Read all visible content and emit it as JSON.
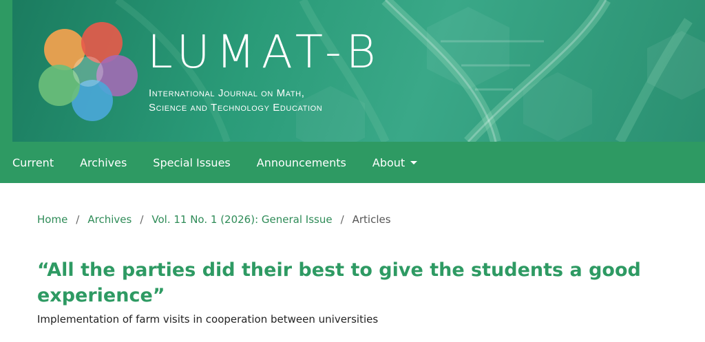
{
  "header": {
    "brand_title": "LUMAT-B",
    "brand_subtitle_line1": "International Journal on Math,",
    "brand_subtitle_line2": "Science and Technology Education"
  },
  "nav": {
    "items": [
      {
        "label": "Current"
      },
      {
        "label": "Archives"
      },
      {
        "label": "Special Issues"
      },
      {
        "label": "Announcements"
      },
      {
        "label": "About"
      }
    ]
  },
  "breadcrumb": {
    "home": "Home",
    "archives": "Archives",
    "issue": "Vol. 11 No. 1 (2026): General Issue",
    "current": "Articles",
    "separator": "/"
  },
  "article": {
    "title": "“All the parties did their best to give the students a good experience”",
    "subtitle": "Implementation of farm visits in cooperation between universities"
  },
  "colors": {
    "nav_green": "#2e9a63",
    "title_green": "#2e9a63",
    "link_green": "#2e8b57"
  }
}
